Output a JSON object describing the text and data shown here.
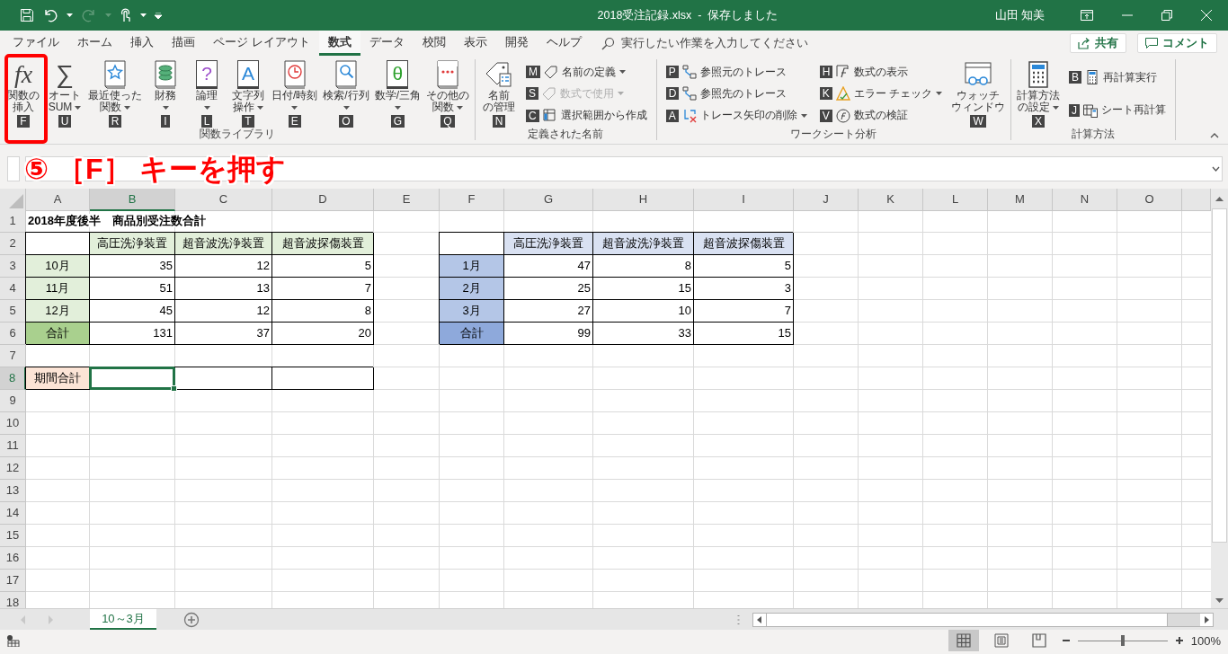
{
  "title_bar": {
    "title": "2018受注記録.xlsx  -  保存しました",
    "user": "山田 知美"
  },
  "tabs": [
    {
      "label": "ファイル",
      "selected": false
    },
    {
      "label": "ホーム",
      "selected": false
    },
    {
      "label": "挿入",
      "selected": false
    },
    {
      "label": "描画",
      "selected": false
    },
    {
      "label": "ページ レイアウト",
      "selected": false
    },
    {
      "label": "数式",
      "selected": true
    },
    {
      "label": "データ",
      "selected": false
    },
    {
      "label": "校閲",
      "selected": false
    },
    {
      "label": "表示",
      "selected": false
    },
    {
      "label": "開発",
      "selected": false
    },
    {
      "label": "ヘルプ",
      "selected": false
    }
  ],
  "tell_me": {
    "placeholder": "実行したい作業を入力してください"
  },
  "share_button": "共有",
  "comment_button": "コメント",
  "ribbon": {
    "groups": [
      {
        "label": "関数ライブラリ",
        "items": [
          {
            "kind": "large",
            "lines": [
              "関数の",
              "挿入"
            ],
            "key": "F",
            "dropdown": false,
            "glyph": "fx"
          },
          {
            "kind": "large",
            "lines": [
              "オート",
              "SUM"
            ],
            "key": "U",
            "dropdown": true,
            "glyph": "∑"
          },
          {
            "kind": "large",
            "lines": [
              "最近使った",
              "関数"
            ],
            "key": "R",
            "dropdown": true
          },
          {
            "kind": "large",
            "lines": [
              "財務"
            ],
            "key": "I",
            "dropdown": true
          },
          {
            "kind": "large",
            "lines": [
              "論理"
            ],
            "key": "L",
            "dropdown": true,
            "glyph": "?"
          },
          {
            "kind": "large",
            "lines": [
              "文字列",
              "操作"
            ],
            "key": "T",
            "dropdown": true,
            "glyph": "A"
          },
          {
            "kind": "large",
            "lines": [
              "日付/時刻"
            ],
            "key": "E",
            "dropdown": true
          },
          {
            "kind": "large",
            "lines": [
              "検索/行列"
            ],
            "key": "O",
            "dropdown": true
          },
          {
            "kind": "large",
            "lines": [
              "数学/三角"
            ],
            "key": "G",
            "dropdown": true,
            "glyph": "θ"
          },
          {
            "kind": "large",
            "lines": [
              "その他の",
              "関数"
            ],
            "key": "Q",
            "dropdown": true
          }
        ]
      },
      {
        "label": "定義された名前",
        "items": [
          {
            "kind": "large",
            "lines": [
              "名前",
              "の管理"
            ],
            "key": "N",
            "dropdown": false
          },
          {
            "kind": "stack",
            "entries": [
              {
                "label": "名前の定義",
                "key": "M",
                "dropdown": true,
                "disabled": false
              },
              {
                "label": "数式で使用",
                "key": "S",
                "dropdown": true,
                "disabled": true
              },
              {
                "label": "選択範囲から作成",
                "key": "C",
                "dropdown": false,
                "disabled": false
              }
            ]
          }
        ]
      },
      {
        "label": "ワークシート分析",
        "items": [
          {
            "kind": "stack",
            "entries": [
              {
                "label": "参照元のトレース",
                "key": "P",
                "dropdown": false,
                "disabled": false
              },
              {
                "label": "参照先のトレース",
                "key": "D",
                "dropdown": false,
                "disabled": false
              },
              {
                "label": "トレース矢印の削除",
                "key": "A",
                "dropdown": true,
                "disabled": false
              }
            ]
          },
          {
            "kind": "stack",
            "entries": [
              {
                "label": "数式の表示",
                "key": "H",
                "dropdown": false,
                "disabled": false
              },
              {
                "label": "エラー チェック",
                "key": "K",
                "dropdown": true,
                "disabled": false
              },
              {
                "label": "数式の検証",
                "key": "V",
                "dropdown": false,
                "disabled": false
              }
            ]
          },
          {
            "kind": "large",
            "lines": [
              "ウォッチ",
              "ウィンドウ"
            ],
            "key": "W",
            "dropdown": false
          }
        ]
      },
      {
        "label": "計算方法",
        "items": [
          {
            "kind": "large",
            "lines": [
              "計算方法",
              "の設定"
            ],
            "key": "X",
            "dropdown": true
          },
          {
            "kind": "stack",
            "entries": [
              {
                "label": "再計算実行",
                "key": "B",
                "dropdown": false,
                "disabled": false
              },
              {
                "label": "シート再計算",
                "key": "J",
                "dropdown": false,
                "disabled": false
              }
            ]
          }
        ]
      }
    ]
  },
  "annotation": {
    "text": "⑤ ［F］ キーを押す"
  },
  "sheet": {
    "columns": [
      {
        "label": "A",
        "selected": false
      },
      {
        "label": "B",
        "selected": true
      },
      {
        "label": "C",
        "selected": false
      },
      {
        "label": "D",
        "selected": false
      },
      {
        "label": "E",
        "selected": false
      },
      {
        "label": "F",
        "selected": false
      },
      {
        "label": "G",
        "selected": false
      },
      {
        "label": "H",
        "selected": false
      },
      {
        "label": "I",
        "selected": false
      },
      {
        "label": "J",
        "selected": false
      },
      {
        "label": "K",
        "selected": false
      },
      {
        "label": "L",
        "selected": false
      },
      {
        "label": "M",
        "selected": false
      },
      {
        "label": "N",
        "selected": false
      },
      {
        "label": "O",
        "selected": false
      }
    ],
    "rows": [
      {
        "label": "1",
        "selected": false,
        "cells": [
          {
            "text": "2018年度後半　商品別受注数合計",
            "kind": "title",
            "selected": false
          }
        ]
      },
      {
        "label": "2",
        "selected": false,
        "cells": [
          {
            "kind": "center",
            "selected": false
          },
          {
            "text": "高圧洗浄装置",
            "kind": "center",
            "color": "#e2efda",
            "selected": false
          },
          {
            "text": "超音波洗浄装置",
            "kind": "center",
            "color": "#e2efda",
            "selected": false
          },
          {
            "text": "超音波探傷装置",
            "kind": "center",
            "color": "#e2efda",
            "selected": false
          },
          null,
          {
            "kind": "center",
            "selected": false
          },
          {
            "text": "高圧洗浄装置",
            "kind": "center",
            "color": "#d9e1f2",
            "selected": false
          },
          {
            "text": "超音波洗浄装置",
            "kind": "center",
            "color": "#d9e1f2",
            "selected": false
          },
          {
            "text": "超音波探傷装置",
            "kind": "center",
            "color": "#d9e1f2",
            "selected": false
          }
        ]
      },
      {
        "label": "3",
        "selected": false,
        "cells": [
          {
            "text": "10月",
            "kind": "center",
            "color": "#e2efda",
            "selected": false
          },
          {
            "text": "35",
            "kind": "number",
            "selected": false
          },
          {
            "text": "12",
            "kind": "number",
            "selected": false
          },
          {
            "text": "5",
            "kind": "number",
            "selected": false
          },
          null,
          {
            "text": "1月",
            "kind": "center",
            "color": "#b4c6e7",
            "selected": false
          },
          {
            "text": "47",
            "kind": "number",
            "selected": false
          },
          {
            "text": "8",
            "kind": "number",
            "selected": false
          },
          {
            "text": "5",
            "kind": "number",
            "selected": false
          }
        ]
      },
      {
        "label": "4",
        "selected": false,
        "cells": [
          {
            "text": "11月",
            "kind": "center",
            "color": "#e2efda",
            "selected": false
          },
          {
            "text": "51",
            "kind": "number",
            "selected": false
          },
          {
            "text": "13",
            "kind": "number",
            "selected": false
          },
          {
            "text": "7",
            "kind": "number",
            "selected": false
          },
          null,
          {
            "text": "2月",
            "kind": "center",
            "color": "#b4c6e7",
            "selected": false
          },
          {
            "text": "25",
            "kind": "number",
            "selected": false
          },
          {
            "text": "15",
            "kind": "number",
            "selected": false
          },
          {
            "text": "3",
            "kind": "number",
            "selected": false
          }
        ]
      },
      {
        "label": "5",
        "selected": false,
        "cells": [
          {
            "text": "12月",
            "kind": "center",
            "color": "#e2efda",
            "selected": false
          },
          {
            "text": "45",
            "kind": "number",
            "selected": false
          },
          {
            "text": "12",
            "kind": "number",
            "selected": false
          },
          {
            "text": "8",
            "kind": "number",
            "selected": false
          },
          null,
          {
            "text": "3月",
            "kind": "center",
            "color": "#b4c6e7",
            "selected": false
          },
          {
            "text": "27",
            "kind": "number",
            "selected": false
          },
          {
            "text": "10",
            "kind": "number",
            "selected": false
          },
          {
            "text": "7",
            "kind": "number",
            "selected": false
          }
        ]
      },
      {
        "label": "6",
        "selected": false,
        "cells": [
          {
            "text": "合計",
            "kind": "center",
            "color": "#a9d08e",
            "selected": false
          },
          {
            "text": "131",
            "kind": "number",
            "selected": false
          },
          {
            "text": "37",
            "kind": "number",
            "selected": false
          },
          {
            "text": "20",
            "kind": "number",
            "selected": false
          },
          null,
          {
            "text": "合計",
            "kind": "center",
            "color": "#8ea9db",
            "selected": false
          },
          {
            "text": "99",
            "kind": "number",
            "selected": false
          },
          {
            "text": "33",
            "kind": "number",
            "selected": false
          },
          {
            "text": "15",
            "kind": "number",
            "selected": false
          }
        ]
      },
      {
        "label": "7",
        "selected": false,
        "cells": []
      },
      {
        "label": "8",
        "selected": true,
        "cells": [
          {
            "text": "期間合計",
            "kind": "center",
            "color": "#fce4d6",
            "selected": false
          },
          {
            "kind": "center",
            "selected": true
          },
          {
            "kind": "center",
            "selected": false
          },
          {
            "kind": "center",
            "selected": false
          }
        ]
      },
      {
        "label": "9",
        "selected": false,
        "cells": []
      },
      {
        "label": "10",
        "selected": false,
        "cells": []
      },
      {
        "label": "11",
        "selected": false,
        "cells": []
      },
      {
        "label": "12",
        "selected": false,
        "cells": []
      },
      {
        "label": "13",
        "selected": false,
        "cells": []
      },
      {
        "label": "14",
        "selected": false,
        "cells": []
      },
      {
        "label": "15",
        "selected": false,
        "cells": []
      },
      {
        "label": "16",
        "selected": false,
        "cells": []
      },
      {
        "label": "17",
        "selected": false,
        "cells": []
      },
      {
        "label": "18",
        "selected": false,
        "cells": []
      }
    ]
  },
  "sheet_tabs": [
    {
      "label": "10～3月",
      "selected": true
    }
  ],
  "status_bar": {
    "views": [
      {
        "selected": true
      },
      {
        "selected": false
      },
      {
        "selected": false
      }
    ],
    "zoom": {
      "level": 0.5,
      "reading": "100%"
    }
  }
}
